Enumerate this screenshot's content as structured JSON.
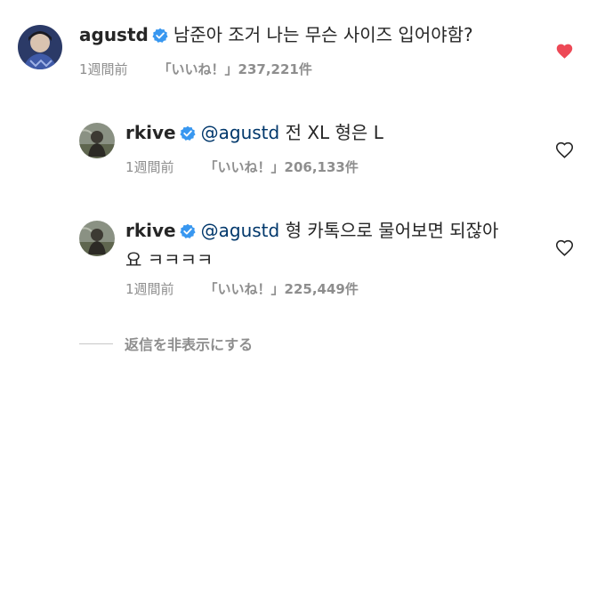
{
  "comments": [
    {
      "username": "agustd",
      "text": "남준아 조거 나는 무슨 사이즈 입어야함?",
      "time": "1週間前",
      "likes": "「いいね！」237,221件",
      "liked": true
    },
    {
      "username": "rkive",
      "mention": "@agustd",
      "text": "전 XL 형은 L",
      "time": "1週間前",
      "likes": "「いいね！」206,133件",
      "liked": false
    },
    {
      "username": "rkive",
      "mention": "@agustd",
      "text": "형 카톡으로 물어보면 되잖아",
      "text_line2": "요 ㅋㅋㅋㅋ",
      "time": "1週間前",
      "likes": "「いいね！」225,449件",
      "liked": false
    }
  ],
  "hide_replies_label": "返信を非表示にする",
  "colors": {
    "liked_heart": "#ed4956",
    "verified_badge": "#3897f0",
    "mention": "#00376b",
    "meta": "#8e8e8e"
  },
  "icons": [
    "verified-badge-icon",
    "heart-icon"
  ]
}
